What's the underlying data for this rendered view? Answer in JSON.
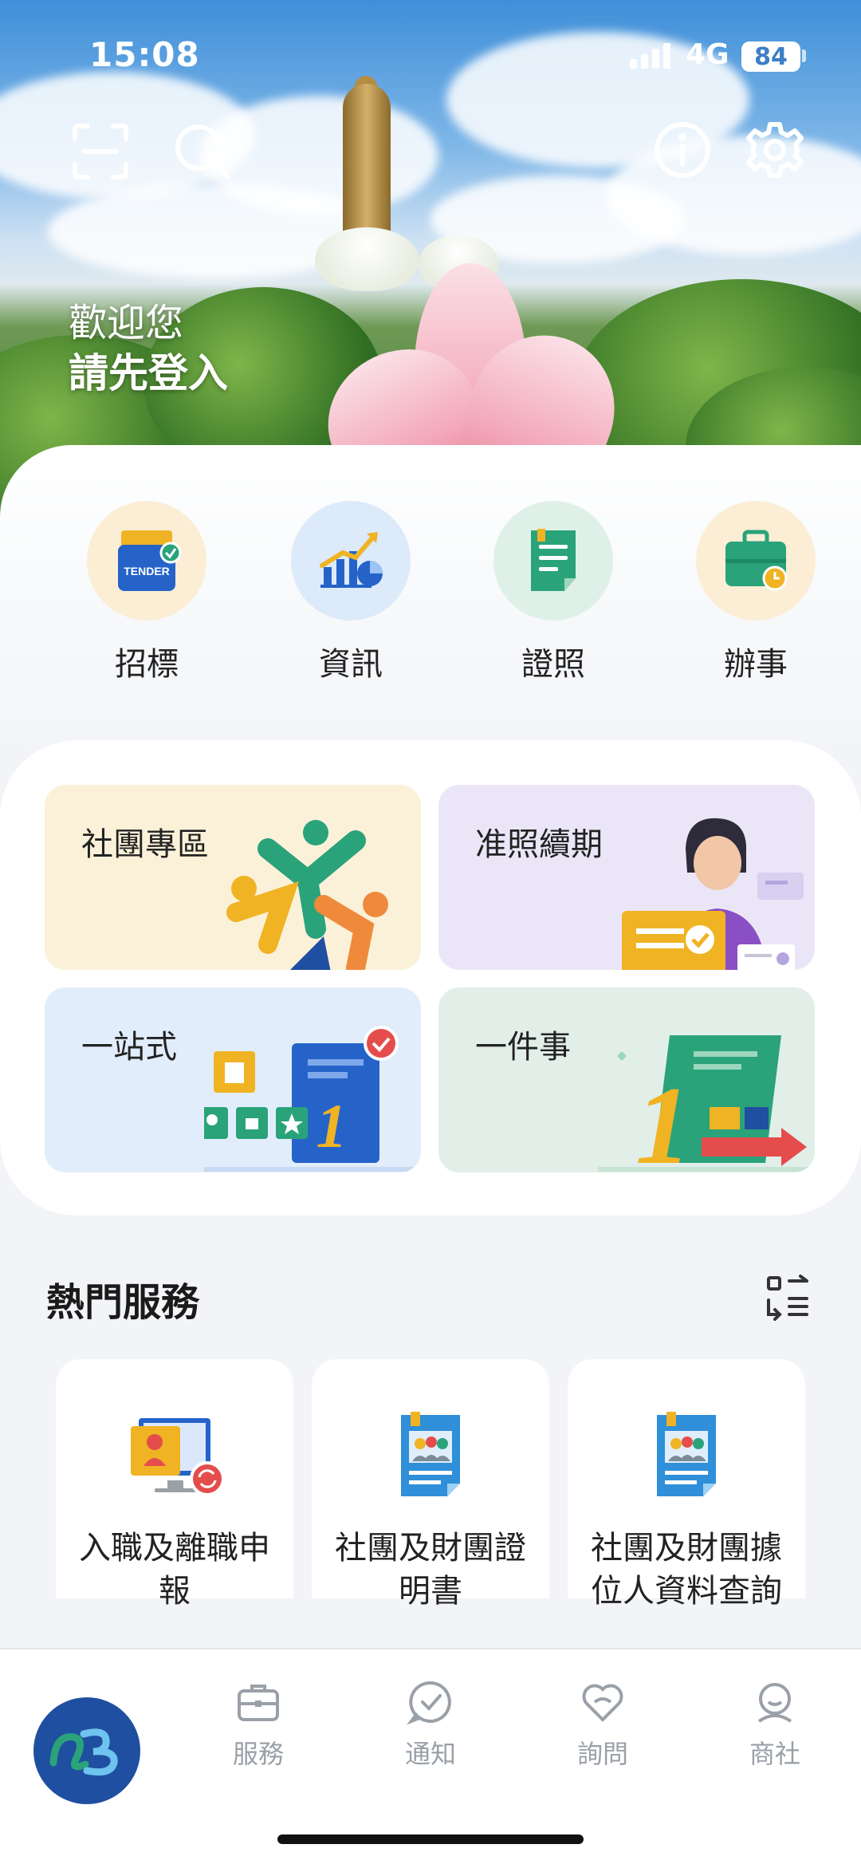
{
  "status_bar": {
    "time": "15:08",
    "network": "4G",
    "battery": "84"
  },
  "hero": {
    "welcome": "歡迎您",
    "login": "請先登入",
    "icons": [
      "scan-icon",
      "search-icon",
      "info-icon",
      "settings-icon"
    ]
  },
  "quick_actions": [
    {
      "label": "招標",
      "icon": "tender-icon",
      "badge": "TENDER"
    },
    {
      "label": "資訊",
      "icon": "chart-icon"
    },
    {
      "label": "證照",
      "icon": "document-icon"
    },
    {
      "label": "辦事",
      "icon": "briefcase-icon"
    }
  ],
  "tiles": [
    {
      "label": "社團專區"
    },
    {
      "label": "准照續期"
    },
    {
      "label": "一站式"
    },
    {
      "label": "一件事"
    }
  ],
  "hot_services": {
    "title": "熱門服務",
    "items": [
      {
        "label": "入職及離職申報"
      },
      {
        "label": "社團及財團證明書"
      },
      {
        "label": "社團及財團據位人資料查詢"
      }
    ]
  },
  "bottom_nav": {
    "items": [
      {
        "label": "服務",
        "icon": "briefcase-icon"
      },
      {
        "label": "通知",
        "icon": "bell-check-icon"
      },
      {
        "label": "詢問",
        "icon": "heart-chat-icon"
      },
      {
        "label": "商社",
        "icon": "person-icon"
      }
    ]
  },
  "colors": {
    "brand_blue": "#1f4fa0",
    "accent_green": "#2aa37a",
    "gold": "#f0b323"
  }
}
